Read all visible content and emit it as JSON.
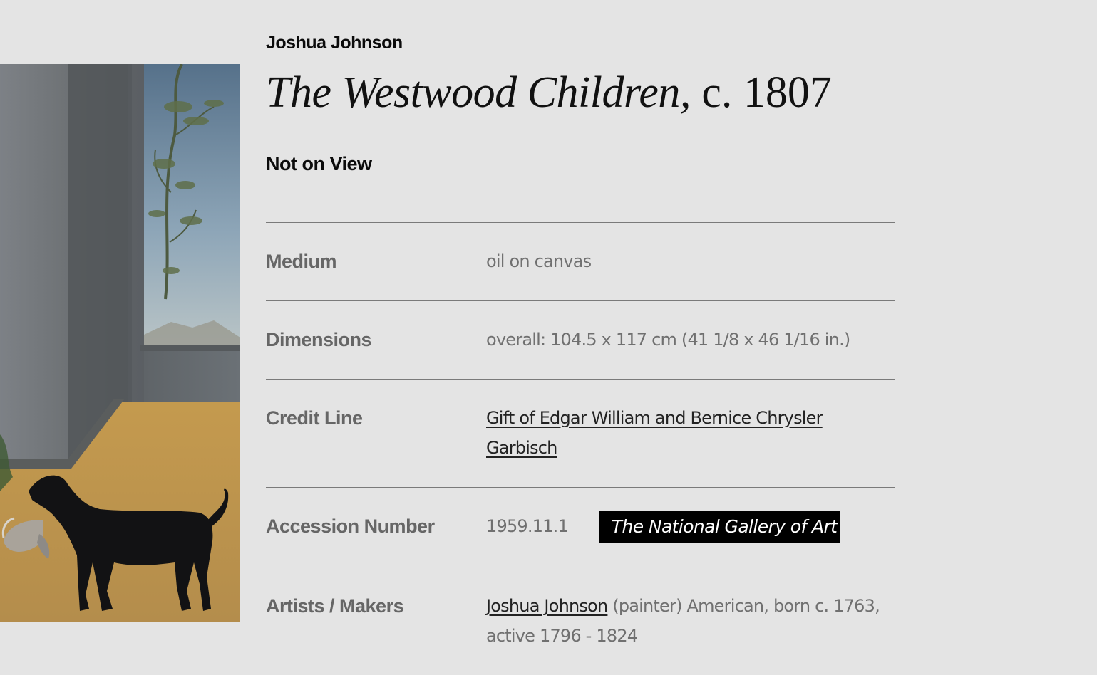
{
  "artwork": {
    "artist": "Joshua Johnson",
    "title": "The Westwood Children,",
    "date": "c. 1807",
    "status": "Not on View",
    "image_alt": "painting detail: black dog holding a bird in its mouth"
  },
  "details": {
    "medium": {
      "label": "Medium",
      "value": "oil on canvas"
    },
    "dimensions": {
      "label": "Dimensions",
      "value": "overall: 104.5 x 117 cm (41 1/8 x 46 1/16 in.)"
    },
    "credit_line": {
      "label": "Credit Line",
      "value": "Gift of Edgar William and Bernice Chrysler Garbisch"
    },
    "accession": {
      "label": "Accession Number",
      "value": "1959.11.1",
      "badge": "The National Gallery of Art"
    },
    "artists": {
      "label": "Artists / Makers",
      "artist_link": "Joshua Johnson",
      "role": "(painter)",
      "bio": "American, born c. 1763, active 1796 - 1824"
    }
  },
  "colors": {
    "background": "#e4e4e4",
    "text_dark": "#0b0b0b",
    "label_gray": "#666666",
    "value_gray": "#707070",
    "divider": "#7a7a7a",
    "badge_bg": "#000000"
  }
}
